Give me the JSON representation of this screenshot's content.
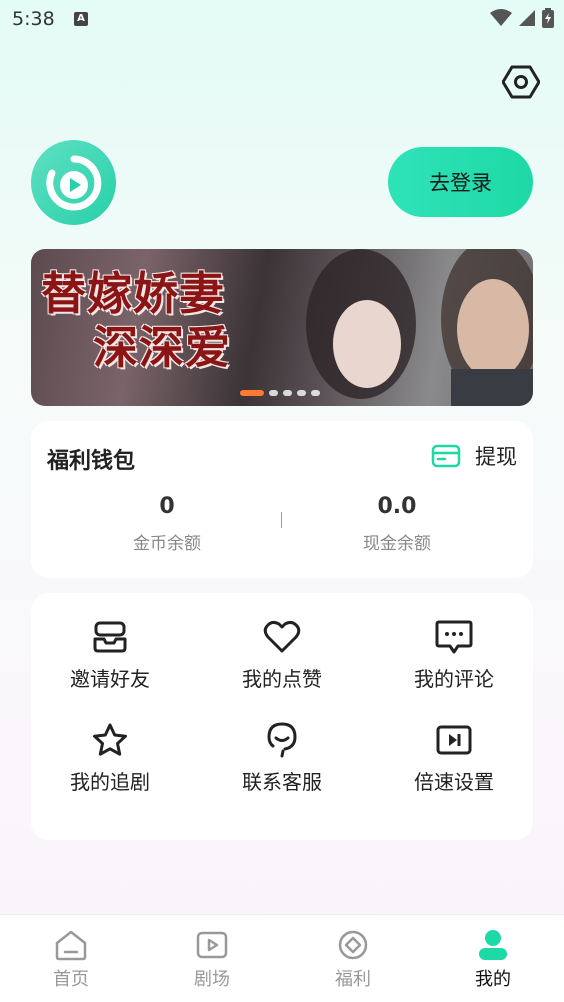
{
  "status_bar": {
    "time": "5:38",
    "notification_badge": "A"
  },
  "header": {
    "login_label": "去登录"
  },
  "banner": {
    "title_line1": "替嫁娇妻",
    "title_line2": "深深爱",
    "active_index": 0,
    "slide_count": 5
  },
  "wallet": {
    "title": "福利钱包",
    "withdraw_label": "提现",
    "coins_value": "0",
    "coins_label": "金币余额",
    "cash_value": "0.0",
    "cash_label": "现金余额"
  },
  "menu": {
    "items": [
      {
        "label": "邀请好友",
        "icon": "invite-icon"
      },
      {
        "label": "我的点赞",
        "icon": "heart-icon"
      },
      {
        "label": "我的评论",
        "icon": "comment-icon"
      },
      {
        "label": "我的追剧",
        "icon": "star-icon"
      },
      {
        "label": "联系客服",
        "icon": "support-icon"
      },
      {
        "label": "倍速设置",
        "icon": "speed-icon"
      }
    ]
  },
  "tabs": [
    {
      "label": "首页",
      "icon": "home-icon"
    },
    {
      "label": "剧场",
      "icon": "theater-icon"
    },
    {
      "label": "福利",
      "icon": "welfare-icon"
    },
    {
      "label": "我的",
      "icon": "profile-icon",
      "active": true
    }
  ],
  "colors": {
    "accent": "#1dd9a5",
    "banner_dot_active": "#ff7a2e",
    "banner_title": "#8b1414"
  }
}
